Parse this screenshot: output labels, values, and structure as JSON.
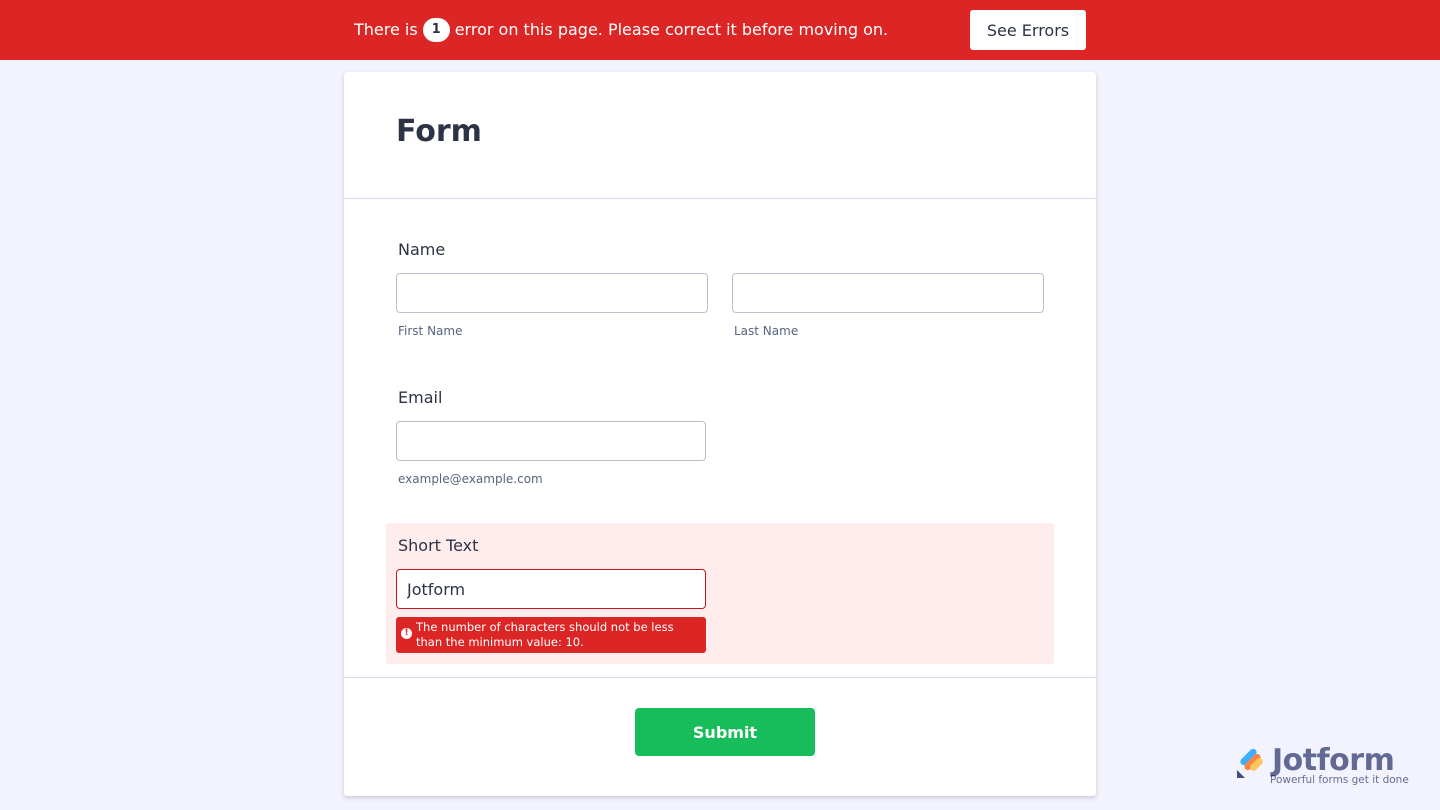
{
  "error_bar": {
    "prefix": "There is",
    "count": "1",
    "suffix": "error on this page. Please correct it before moving on.",
    "button_label": "See Errors"
  },
  "form": {
    "title": "Form",
    "name_field": {
      "label": "Name",
      "first_value": "",
      "first_sublabel": "First Name",
      "last_value": "",
      "last_sublabel": "Last Name"
    },
    "email_field": {
      "label": "Email",
      "value": "",
      "sublabel": "example@example.com"
    },
    "short_text_field": {
      "label": "Short Text",
      "value": "Jotform",
      "error_icon": "!",
      "error_message": "The number of characters should not be less than the minimum value: 10."
    },
    "submit_label": "Submit"
  },
  "branding": {
    "name": "Jotform",
    "tagline": "Powerful forms get it done",
    "logo_icon": "jotform-logo-icon"
  },
  "colors": {
    "error_red": "#dc2626",
    "submit_green": "#18bd5b",
    "page_bg": "#f3f3fe",
    "error_field_bg": "#ffeded"
  }
}
